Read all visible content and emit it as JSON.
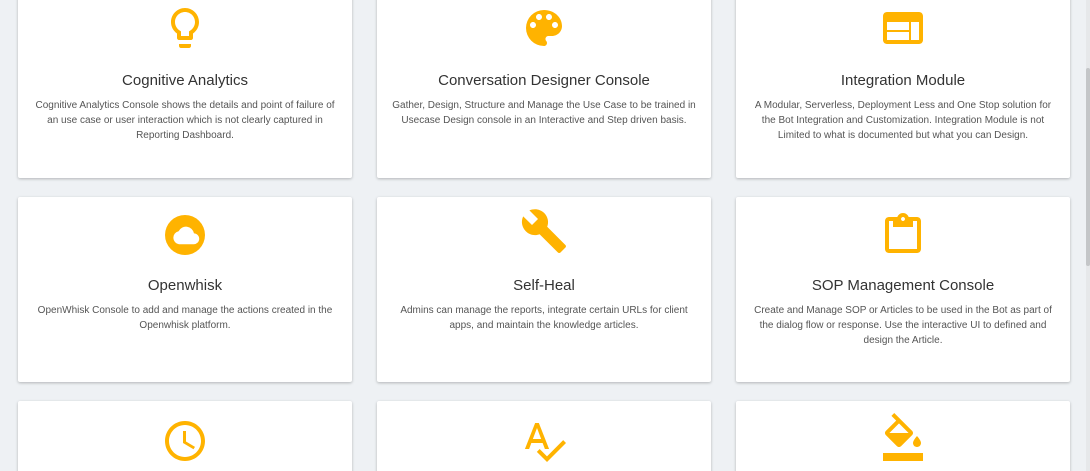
{
  "accent_color": "#ffb300",
  "cards": [
    {
      "icon": "lightbulb-icon",
      "title": "Cognitive Analytics",
      "description": "Cognitive Analytics Console shows the details and point of failure of an use case or user interaction which is not clearly captured in Reporting Dashboard."
    },
    {
      "icon": "palette-icon",
      "title": "Conversation Designer Console",
      "description": "Gather, Design, Structure and Manage the Use Case to be trained in Usecase Design console in an Interactive and Step driven basis."
    },
    {
      "icon": "web-layout-icon",
      "title": "Integration Module",
      "description": "A Modular, Serverless, Deployment Less and One Stop solution for the Bot Integration and Customization. Integration Module is not Limited to what is documented but what you can Design."
    },
    {
      "icon": "cloud-icon",
      "title": "Openwhisk",
      "description": "OpenWhisk Console to add and manage the actions created in the Openwhisk platform."
    },
    {
      "icon": "wrench-icon",
      "title": "Self-Heal",
      "description": "Admins can manage the reports, integrate certain URLs for client apps, and maintain the knowledge articles."
    },
    {
      "icon": "clipboard-icon",
      "title": "SOP Management Console",
      "description": "Create and Manage SOP or Articles to be used in the Bot as part of the dialog flow or response. Use the interactive UI to defined and design the Article."
    },
    {
      "icon": "clock-icon",
      "title": "",
      "description": ""
    },
    {
      "icon": "spellcheck-icon",
      "title": "",
      "description": ""
    },
    {
      "icon": "paint-bucket-icon",
      "title": "",
      "description": ""
    }
  ]
}
